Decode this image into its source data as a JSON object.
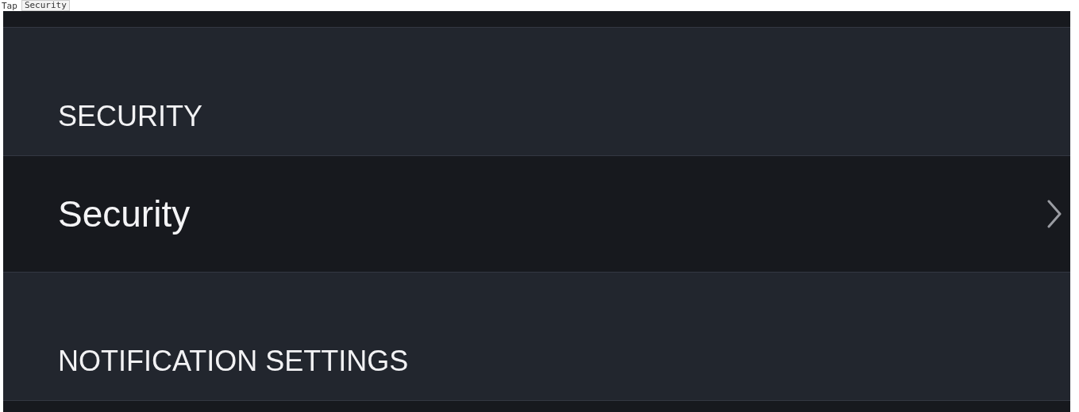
{
  "caption": {
    "text": "Tap",
    "code": "Security"
  },
  "sections": [
    {
      "header": "SECURITY",
      "rows": [
        {
          "label": "Security",
          "kind": "link"
        }
      ]
    },
    {
      "header": "NOTIFICATION SETTINGS"
    }
  ]
}
